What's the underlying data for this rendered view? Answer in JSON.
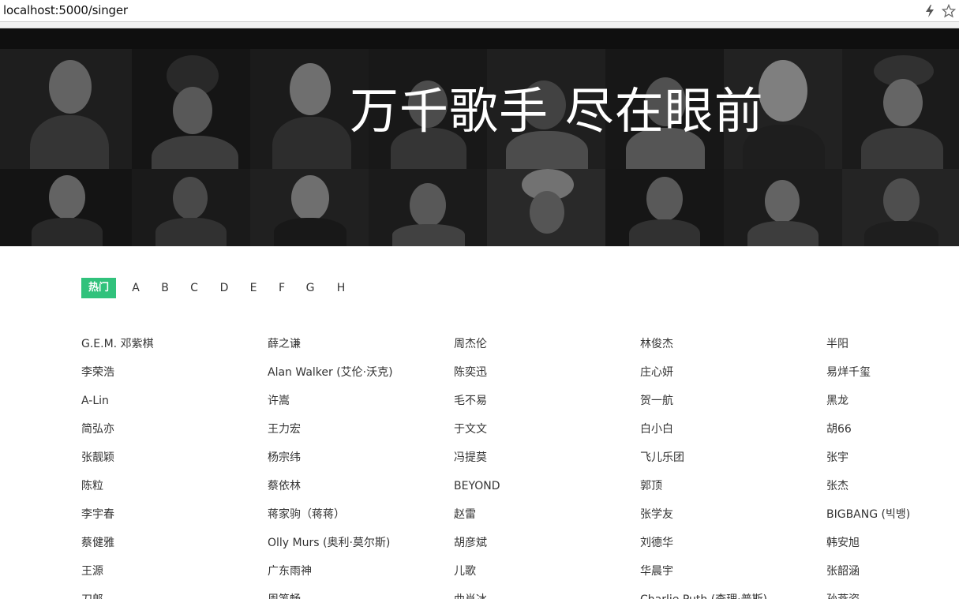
{
  "browser": {
    "url": "localhost:5000/singer"
  },
  "banner": {
    "title": "万千歌手 尽在眼前"
  },
  "tabs": [
    {
      "label": "热门",
      "active": true
    },
    {
      "label": "A",
      "active": false
    },
    {
      "label": "B",
      "active": false
    },
    {
      "label": "C",
      "active": false
    },
    {
      "label": "D",
      "active": false
    },
    {
      "label": "E",
      "active": false
    },
    {
      "label": "F",
      "active": false
    },
    {
      "label": "G",
      "active": false
    },
    {
      "label": "H",
      "active": false
    }
  ],
  "colors": {
    "accent": "#31c27c",
    "text": "#333333",
    "banner_bg": "#161616"
  },
  "singers": [
    [
      "G.E.M. 邓紫棋",
      "李荣浩",
      "A-Lin",
      "简弘亦",
      "张靓颖",
      "陈粒",
      "李宇春",
      "蔡健雅",
      "王源",
      "刀郎"
    ],
    [
      "薛之谦",
      "Alan Walker (艾伦·沃克)",
      "许嵩",
      "王力宏",
      "杨宗纬",
      "蔡依林",
      "蒋家驹（蒋蒋）",
      "Olly Murs (奥利·莫尔斯)",
      "广东雨神",
      "周笔畅"
    ],
    [
      "周杰伦",
      "陈奕迅",
      "毛不易",
      "于文文",
      "冯提莫",
      "BEYOND",
      "赵雷",
      "胡彦斌",
      "儿歌",
      "曲肖冰"
    ],
    [
      "林俊杰",
      "庄心妍",
      "贺一航",
      "白小白",
      "飞儿乐团",
      "郭顶",
      "张学友",
      "刘德华",
      "华晨宇",
      "Charlie Puth (查理·普斯)"
    ],
    [
      "半阳",
      "易烊千玺",
      "黑龙",
      "胡66",
      "张宇",
      "张杰",
      "BIGBANG (빅뱅)",
      "韩安旭",
      "张韶涵",
      "孙燕姿"
    ]
  ]
}
